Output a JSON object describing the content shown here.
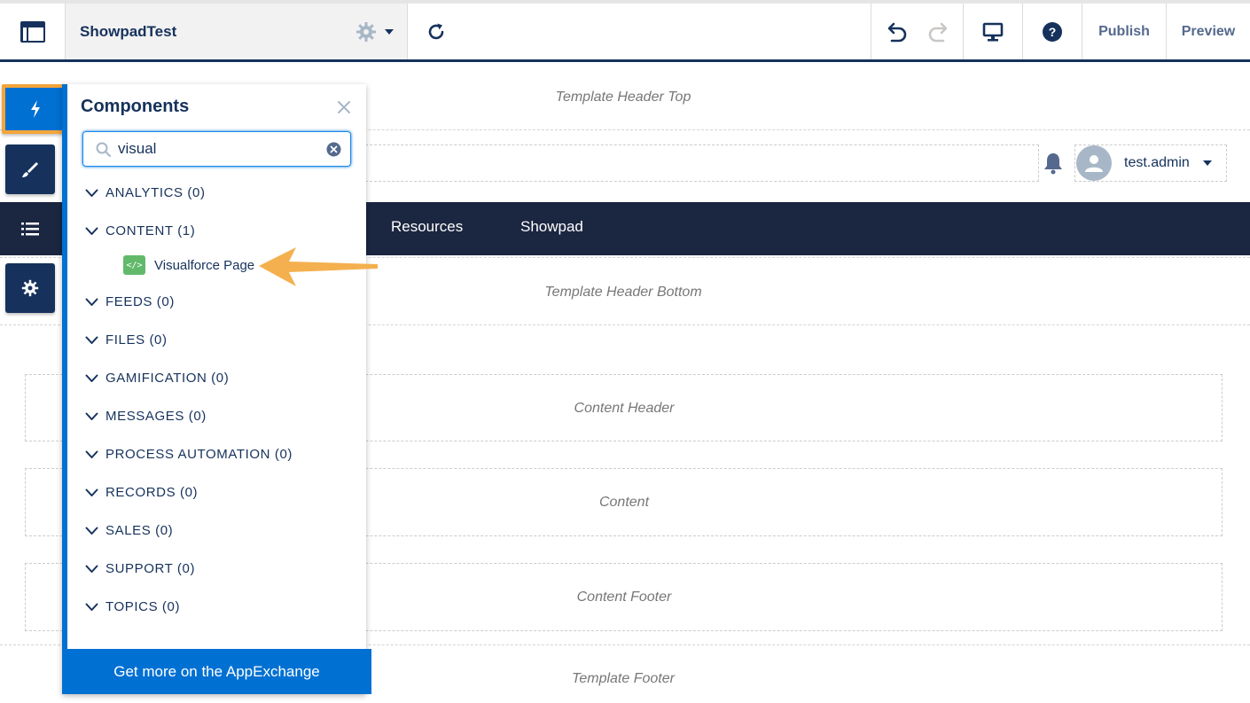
{
  "toolbar": {
    "site_name": "ShowpadTest",
    "publish_label": "Publish",
    "preview_label": "Preview"
  },
  "canvas": {
    "template_header_top": "Template Header Top",
    "template_header_bottom": "Template Header Bottom",
    "content_header": "Content Header",
    "content": "Content",
    "content_footer": "Content Footer",
    "template_footer": "Template Footer",
    "user_name": "test.admin",
    "nav_items": [
      {
        "label": "Resources"
      },
      {
        "label": "Showpad"
      }
    ]
  },
  "panel": {
    "title": "Components",
    "search_value": "visual",
    "categories": [
      {
        "label": "ANALYTICS (0)"
      },
      {
        "label": "CONTENT (1)"
      },
      {
        "label": "FEEDS (0)"
      },
      {
        "label": "FILES (0)"
      },
      {
        "label": "GAMIFICATION (0)"
      },
      {
        "label": "MESSAGES (0)"
      },
      {
        "label": "PROCESS AUTOMATION (0)"
      },
      {
        "label": "RECORDS (0)"
      },
      {
        "label": "SALES (0)"
      },
      {
        "label": "SUPPORT (0)"
      },
      {
        "label": "TOPICS (0)"
      }
    ],
    "component_item": {
      "icon_text": "</>",
      "label": "Visualforce Page"
    },
    "footer_label": "Get more on the AppExchange"
  },
  "colors": {
    "accent": "#0070d2",
    "navy": "#16325c",
    "highlight": "#f4a53a",
    "vf_green": "#62b96b"
  }
}
